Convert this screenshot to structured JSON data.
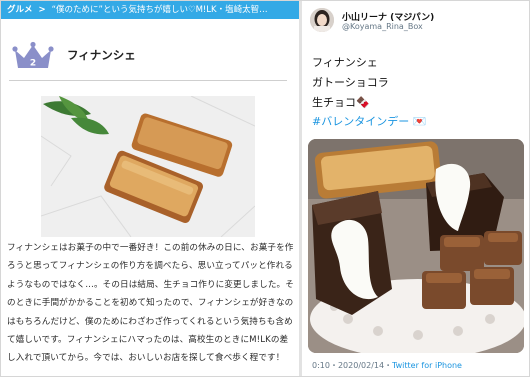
{
  "article": {
    "breadcrumb": {
      "category": "グルメ",
      "separator": ">",
      "current": "“僕のために”という気持ちが嬉しい♡M!LK・塩崎太智…"
    },
    "rank": {
      "number": "2",
      "title": "フィナンシェ"
    },
    "body": "フィナンシェはお菓子の中で一番好き！この前の休みの日に、お菓子を作ろうと思ってフィナンシェの作り方を調べたら、思い立ってパッと作れるようなものではなく…。その日は結局、生チョコ作りに変更しました。そのときに手間がかかることを初めて知ったので、フィナンシェが好きなのはもちろんだけど、僕のためにわざわざ作ってくれるという気持ちも含めて嬉しいです。フィナンシェにハマったのは、高校生のときにM!LKの差し入れで頂いてから。今では、おいしいお店を探して食べ歩く程です！"
  },
  "tweet": {
    "user_name": "小山リーナ (マジパン)",
    "handle": "@Koyama_Rina_Box",
    "lines": [
      "フィナンシェ",
      "ガトーショコラ",
      "生チョコ🍫"
    ],
    "hashtag": "#バレンタインデー 💌",
    "time": "0:10",
    "date_sep": "・",
    "date": "2020/02/14",
    "source_sep": "・",
    "source": "Twitter for iPhone"
  },
  "colors": {
    "breadcrumb_bg": "#33a9e6",
    "crown": "#8a8fc9",
    "hashtag": "#1b95e0"
  },
  "icons": {
    "crown": "crown-icon",
    "emoji_chocolate": "chocolate-bar-emoji",
    "emoji_letter": "love-letter-emoji"
  }
}
